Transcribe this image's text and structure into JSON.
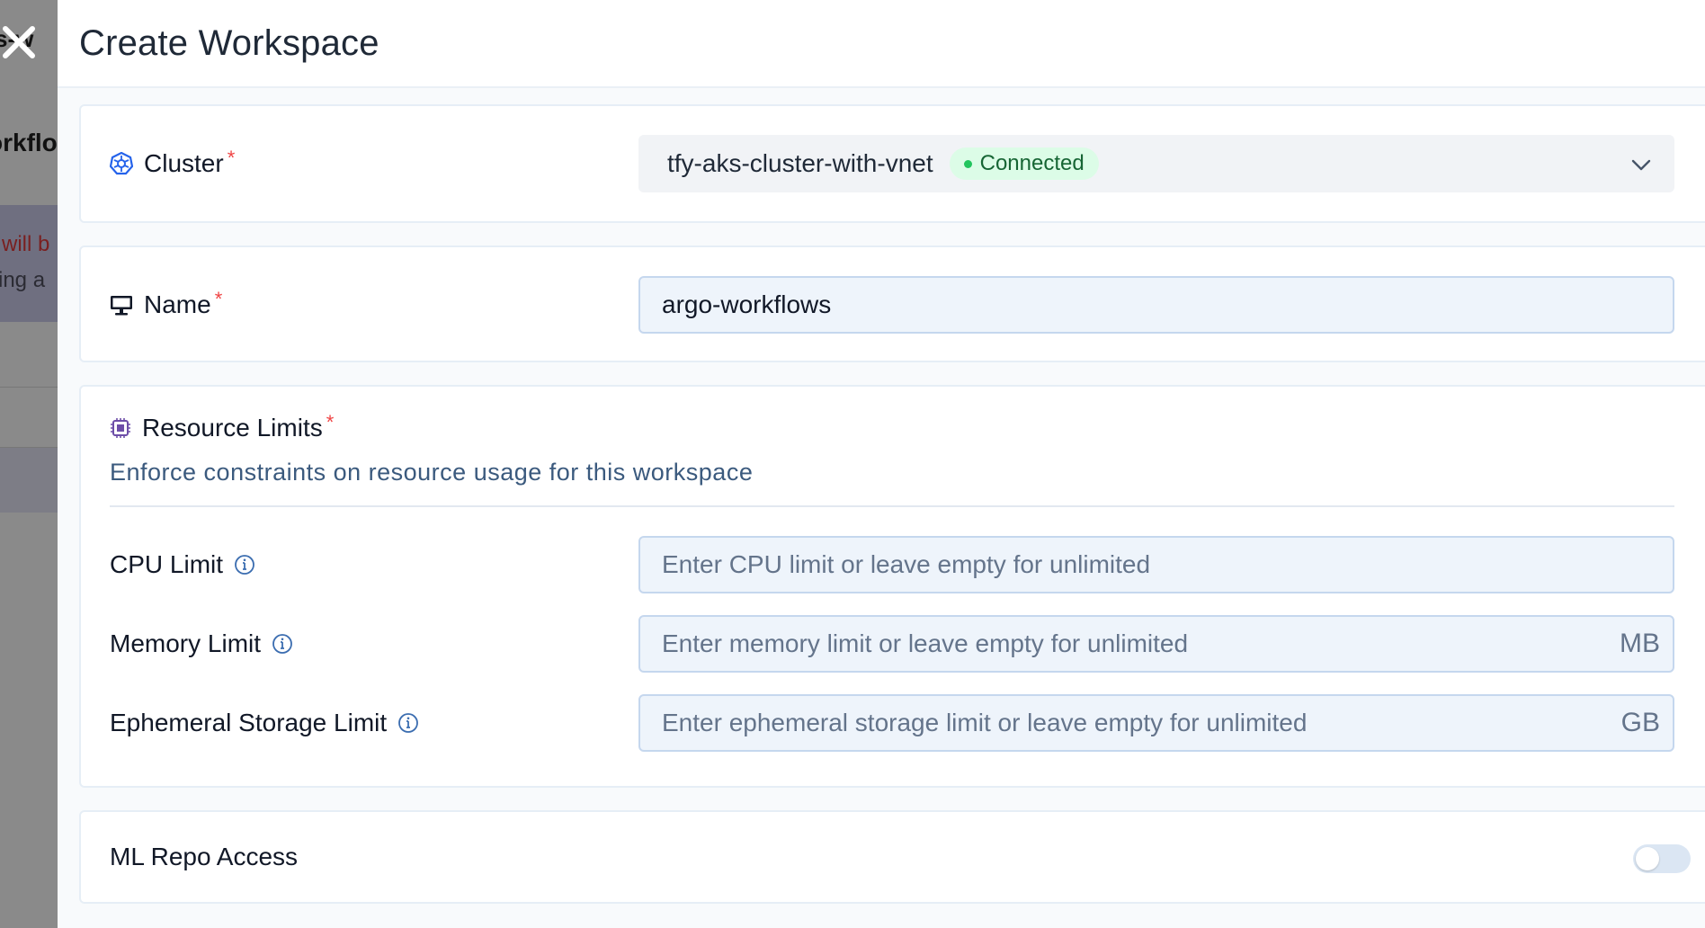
{
  "background": {
    "title_fragment": "s-w",
    "subtitle_fragment": "orkflo",
    "warning_line1": "will b",
    "warning_line2": "ing a"
  },
  "drawer": {
    "title": "Create Workspace",
    "cluster": {
      "label": "Cluster",
      "required_mark": "*",
      "selected_value": "tfy-aks-cluster-with-vnet",
      "status_badge": "Connected",
      "icon": "kubernetes-helm-icon"
    },
    "name": {
      "label": "Name",
      "required_mark": "*",
      "value": "argo-workflows",
      "icon": "monitor-icon"
    },
    "resource_limits": {
      "label": "Resource Limits",
      "required_mark": "*",
      "description": "Enforce constraints on resource usage for this workspace",
      "icon": "cpu-chip-icon",
      "cpu": {
        "label": "CPU Limit",
        "placeholder": "Enter CPU limit or leave empty for unlimited",
        "value": ""
      },
      "memory": {
        "label": "Memory Limit",
        "placeholder": "Enter memory limit or leave empty for unlimited",
        "value": "",
        "unit": "MB"
      },
      "ephemeral": {
        "label": "Ephemeral Storage Limit",
        "placeholder": "Enter ephemeral storage limit or leave empty for unlimited",
        "value": "",
        "unit": "GB"
      }
    },
    "ml_repo_access": {
      "label": "ML Repo Access",
      "enabled": false
    }
  },
  "colors": {
    "accent": "#2563eb",
    "required": "#ef4444",
    "badge_bg": "#dcfce7",
    "badge_text": "#166534",
    "description_text": "#3b5a7e"
  }
}
